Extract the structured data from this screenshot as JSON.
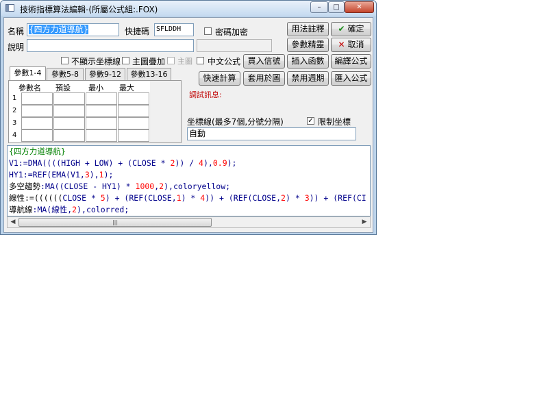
{
  "window": {
    "title": "技術指標算法編輯-(所屬公式組:.FOX)",
    "controls": {
      "minimize": "–",
      "maximize": "□",
      "close": "✕"
    }
  },
  "form": {
    "name_label": "名稱",
    "name_value": "{四方力道導航}",
    "shortcut_label": "快捷碼",
    "shortcut_value": "SFLDDH",
    "password_label": "密碼加密",
    "desc_label": "說明",
    "desc_value": ""
  },
  "options": {
    "hide_axis_label": "不顯示坐標線",
    "main_overlay_label": "主圖疊加",
    "main_chart_label": "主圖",
    "chinese_formula_label": "中文公式"
  },
  "buttons": {
    "usage_notes": "用法註釋",
    "confirm": "確定",
    "param_tune": "參數精靈",
    "cancel": "取消",
    "buy_sell_signal": "買入信號",
    "insert_function": "插入函數",
    "compile_formula": "編譯公式",
    "quick_calc": "快速計算",
    "apply_to_chart": "套用於圖",
    "disable_period": "禁用週期",
    "import_formula": "匯入公式"
  },
  "tabs": [
    "參數1-4",
    "參數5-8",
    "參數9-12",
    "參數13-16"
  ],
  "param_table": {
    "headers": [
      "參數名",
      "預設",
      "最小",
      "最大"
    ],
    "rows": [
      "1",
      "2",
      "3",
      "4"
    ]
  },
  "debug_label": "調試訊息:",
  "axis": {
    "label": "坐標線(最多7個,分號分隔)",
    "limit_label": "限制坐標",
    "value": "自動"
  },
  "code": {
    "line1": "{四方力道導航}",
    "line2": {
      "a": "V1:=",
      "b": "DMA",
      "c": "((((",
      "d": "HIGH",
      "e": " + ",
      "f": "LOW",
      "g": ") + (",
      "h": "CLOSE",
      "i": " * ",
      "j": "2",
      "k": ")) / ",
      "l": "4",
      "m": "),",
      "n": "0.9",
      "o": ");"
    },
    "line3": {
      "a": "HY1:=",
      "b": "REF",
      "c": "(",
      "d": "EMA",
      "e": "(V1,",
      "f": "3",
      "g": "),",
      "h": "1",
      "i": ");"
    },
    "line4": {
      "a": "多空趨勢",
      "b": ":",
      "c": "MA",
      "d": "((",
      "e": "CLOSE",
      "f": " - HY1) * ",
      "g": "1000",
      "h": ",",
      "i": "2",
      "j": "),",
      "k": "coloryellow",
      "l": ";"
    },
    "line5": {
      "a": "線性:=((((((",
      "b": "CLOSE",
      "c": " * ",
      "d": "5",
      "e": ") + (",
      "f": "REF",
      "g": "(",
      "h": "CLOSE",
      "i": ",",
      "j": "1",
      "k": ") * ",
      "l": "4",
      "m": ")) + (",
      "n": "REF",
      "o": "(",
      "p": "CLOSE",
      "q": ",",
      "r": "2",
      "s": ") * ",
      "t": "3",
      "u": ")) + (",
      "v": "REF",
      "w": "(CI"
    },
    "line6": {
      "a": "導航線",
      "b": ":",
      "c": "MA",
      "d": "(線性,",
      "e": "2",
      "f": "),",
      "g": "colorred",
      "h": ";"
    }
  },
  "scrollbar": {
    "left": "◀",
    "right": "▶",
    "grip": "|||"
  }
}
